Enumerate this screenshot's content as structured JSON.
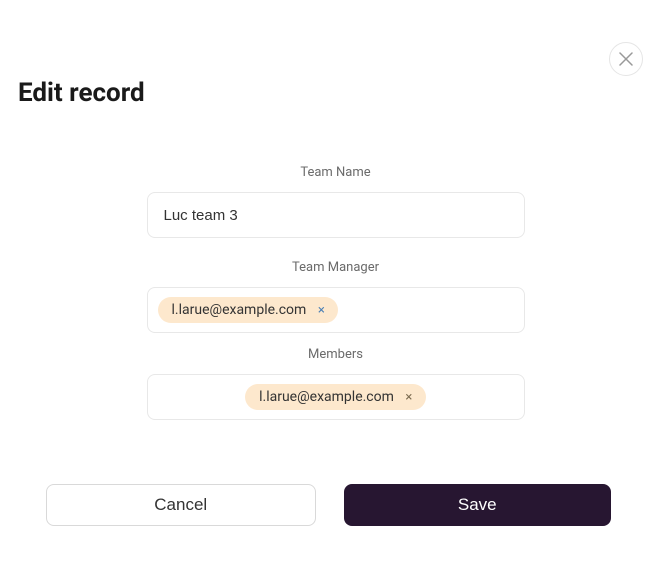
{
  "dialog": {
    "title": "Edit record"
  },
  "fields": {
    "team_name": {
      "label": "Team Name",
      "value": "Luc team 3"
    },
    "team_manager": {
      "label": "Team Manager",
      "tags": [
        {
          "text": "l.larue@example.com"
        }
      ]
    },
    "members": {
      "label": "Members",
      "tags": [
        {
          "text": "l.larue@example.com"
        }
      ]
    }
  },
  "buttons": {
    "cancel": "Cancel",
    "save": "Save"
  }
}
